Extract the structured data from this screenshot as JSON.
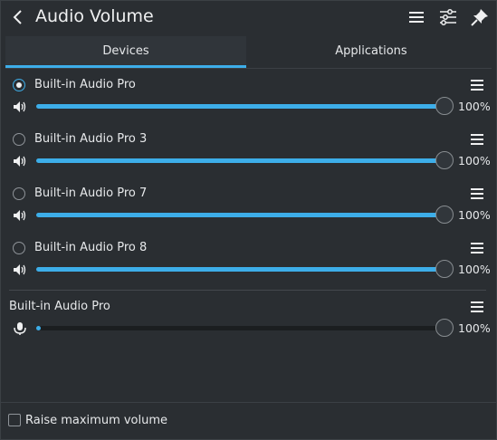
{
  "header": {
    "title": "Audio Volume"
  },
  "tabs": [
    {
      "label": "Devices"
    },
    {
      "label": "Applications"
    }
  ],
  "devices": [
    {
      "name": "Built-in Audio Pro",
      "selected": true,
      "volume_percent": 100,
      "volume_label": "100%"
    },
    {
      "name": "Built-in Audio Pro 3",
      "selected": false,
      "volume_percent": 100,
      "volume_label": "100%"
    },
    {
      "name": "Built-in Audio Pro 7",
      "selected": false,
      "volume_percent": 100,
      "volume_label": "100%"
    },
    {
      "name": "Built-in Audio Pro 8",
      "selected": false,
      "volume_percent": 100,
      "volume_label": "100%"
    }
  ],
  "input_device": {
    "name": "Built-in Audio Pro",
    "volume_percent": 100,
    "level_percent": 1,
    "volume_label": "100%"
  },
  "footer": {
    "raise_max_label": "Raise maximum volume",
    "checked": false
  },
  "colors": {
    "accent": "#3daee9",
    "background": "#2a2e32",
    "text": "#e6e8ea"
  },
  "icons": [
    "back-arrow-icon",
    "hamburger-menu-icon",
    "mixer-settings-icon",
    "pin-icon",
    "speaker-icon",
    "microphone-icon"
  ]
}
